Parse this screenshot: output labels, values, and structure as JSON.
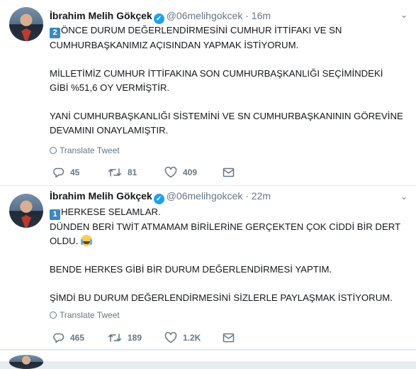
{
  "tweets": [
    {
      "author": "İbrahim Melih Gökçek",
      "handle": "@06melihgokcek",
      "separator": "·",
      "time": "16m",
      "keycap": "2",
      "paragraphs": [
        "ÖNCE DURUM DEĞERLENDİRMESİNİ CUMHUR İTTİFAKI VE SN CUMHURBAŞKANIMIZ AÇISINDAN YAPMAK İSTİYORUM.",
        "MİLLETİMİZ CUMHUR İTTİFAKINA SON CUMHURBAŞKANLIĞI SEÇİMİNDEKİ GİBİ %51,6 OY VERMİŞTİR.",
        "YANİ CUMHURBAŞKANLIĞI SİSTEMİNİ VE SN CUMHURBAŞKANININ GÖREVİNE DEVAMINI ONAYLAMIŞTIR."
      ],
      "translate_label": "Translate Tweet",
      "replies": "45",
      "retweets": "81",
      "likes": "409"
    },
    {
      "author": "İbrahim Melih Gökçek",
      "handle": "@06melihgokcek",
      "separator": "·",
      "time": "22m",
      "keycap": "1",
      "paragraphs": [
        "HERKESE SELAMLAR.",
        "DÜNDEN BERİ TWİT ATMAMAM BİRİLERİNE GERÇEKTEN ÇOK CİDDİ BİR DERT OLDU.",
        "BENDE HERKES GİBİ BİR DURUM DEĞERLENDİRMESİ YAPTIM.",
        "ŞİMDİ BU DURUM DEĞERLENDİRMESİNİ SİZLERLE PAYLAŞMAK İSTİYORUM."
      ],
      "translate_label": "Translate Tweet",
      "replies": "465",
      "retweets": "189",
      "likes": "1.2K"
    }
  ],
  "icons": {
    "verified": "verified-badge-icon",
    "keycap_2": "keycap-digit-two-emoji",
    "keycap_1": "keycap-digit-one-emoji",
    "emoji": "face-with-tears-of-joy-emoji",
    "chevron": "chevron-down-icon",
    "globe": "globe-icon",
    "reply": "reply-icon",
    "retweet": "retweet-icon",
    "like": "heart-icon",
    "dm": "envelope-icon"
  },
  "colors": {
    "verified": "#1da1f2",
    "secondary_text": "#657786",
    "keycap": "#3b88c3",
    "divider": "#e6ecf0"
  }
}
